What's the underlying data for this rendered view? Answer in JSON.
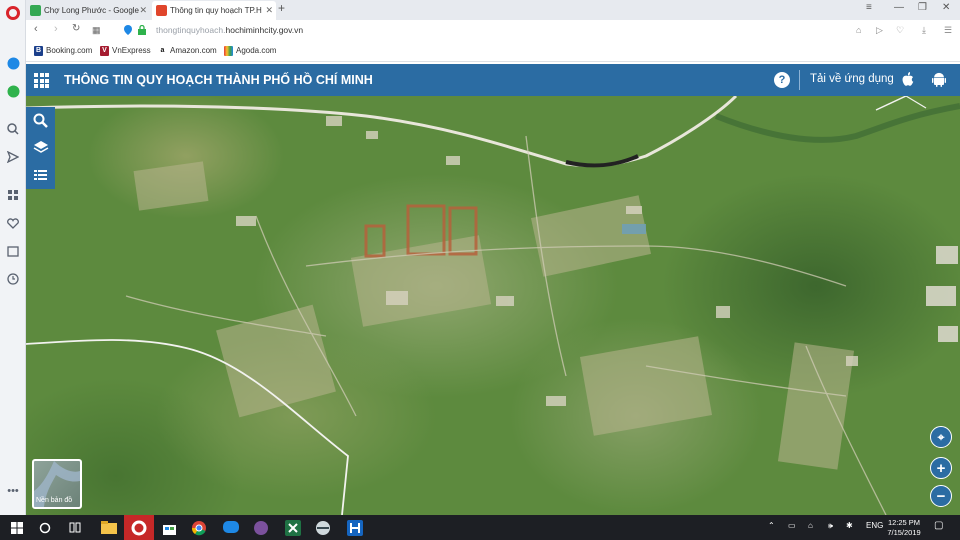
{
  "browser": {
    "tabs": [
      {
        "title": "Chợ Long Phước - Google",
        "active": false
      },
      {
        "title": "Thông tin quy hoạch TP.H",
        "active": true
      }
    ],
    "new_tab_label": "+",
    "url_dim": "thongtinquyhoach.",
    "url_main": "hochiminhcity.gov.vn",
    "bookmarks": [
      {
        "label": "Booking.com",
        "icon": "B"
      },
      {
        "label": "VnExpress",
        "icon": "V"
      },
      {
        "label": "Amazon.com",
        "icon": "a"
      },
      {
        "label": "Agoda.com",
        "icon": ""
      }
    ]
  },
  "site": {
    "title": "THÔNG TIN QUY HOẠCH THÀNH PHỐ HỒ CHÍ MINH",
    "help_label": "?",
    "download_label": "Tải về ứng dụng"
  },
  "map": {
    "basemap_label": "Nền bản đồ",
    "zoom_in_label": "+",
    "zoom_out_label": "−"
  },
  "taskbar": {
    "language": "ENG",
    "time": "12:25 PM",
    "date": "7/15/2019"
  },
  "colors": {
    "header": "#2b6ca3",
    "opera_red": "#d9242b",
    "taskbar": "#1d1f24"
  }
}
